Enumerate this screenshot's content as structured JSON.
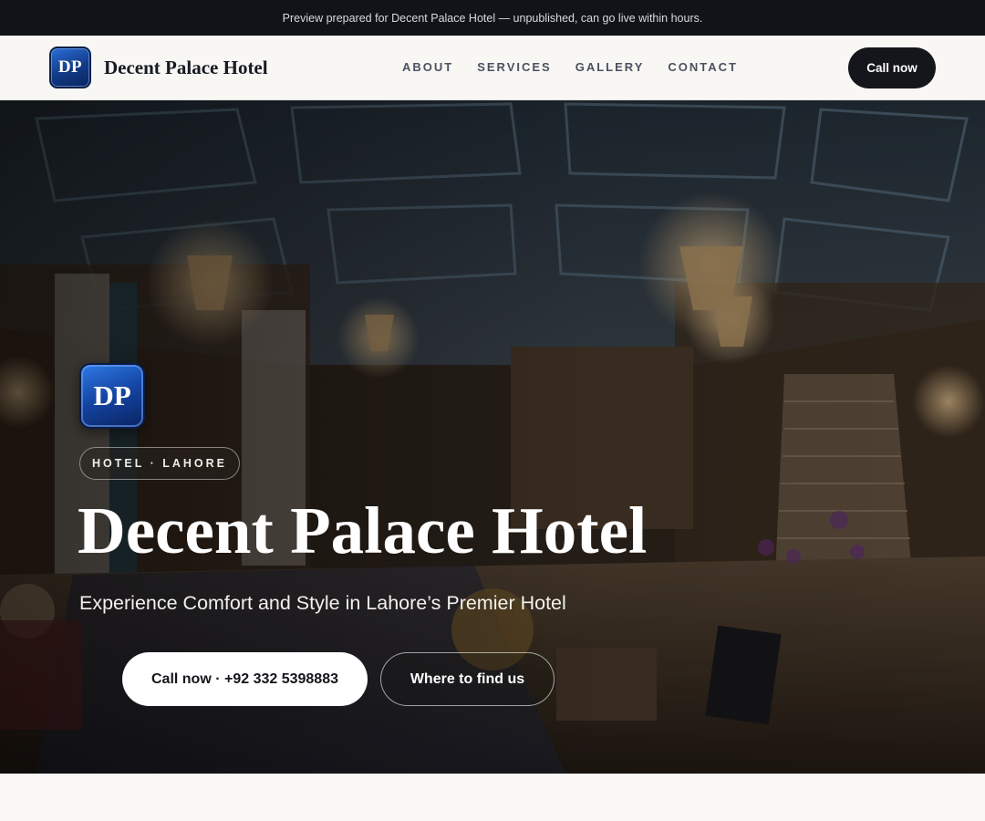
{
  "banner": {
    "text": "Preview prepared for Decent Palace Hotel — unpublished, can go live within hours."
  },
  "brand": {
    "initials": "DP",
    "name": "Decent Palace Hotel"
  },
  "nav": {
    "items": [
      "ABOUT",
      "SERVICES",
      "GALLERY",
      "CONTACT"
    ],
    "cta": "Call now"
  },
  "hero": {
    "initials": "DP",
    "tag": "HOTEL · LAHORE",
    "title": "Decent Palace Hotel",
    "subtitle": "Experience Comfort and Style in Lahore’s Premier Hotel",
    "primary_button": "Call now · +92 332 5398883",
    "secondary_button": "Where to find us"
  },
  "colors": {
    "dark": "#14161c",
    "brand_blue": "#1443a0",
    "page_bg": "#f9f8f5"
  }
}
